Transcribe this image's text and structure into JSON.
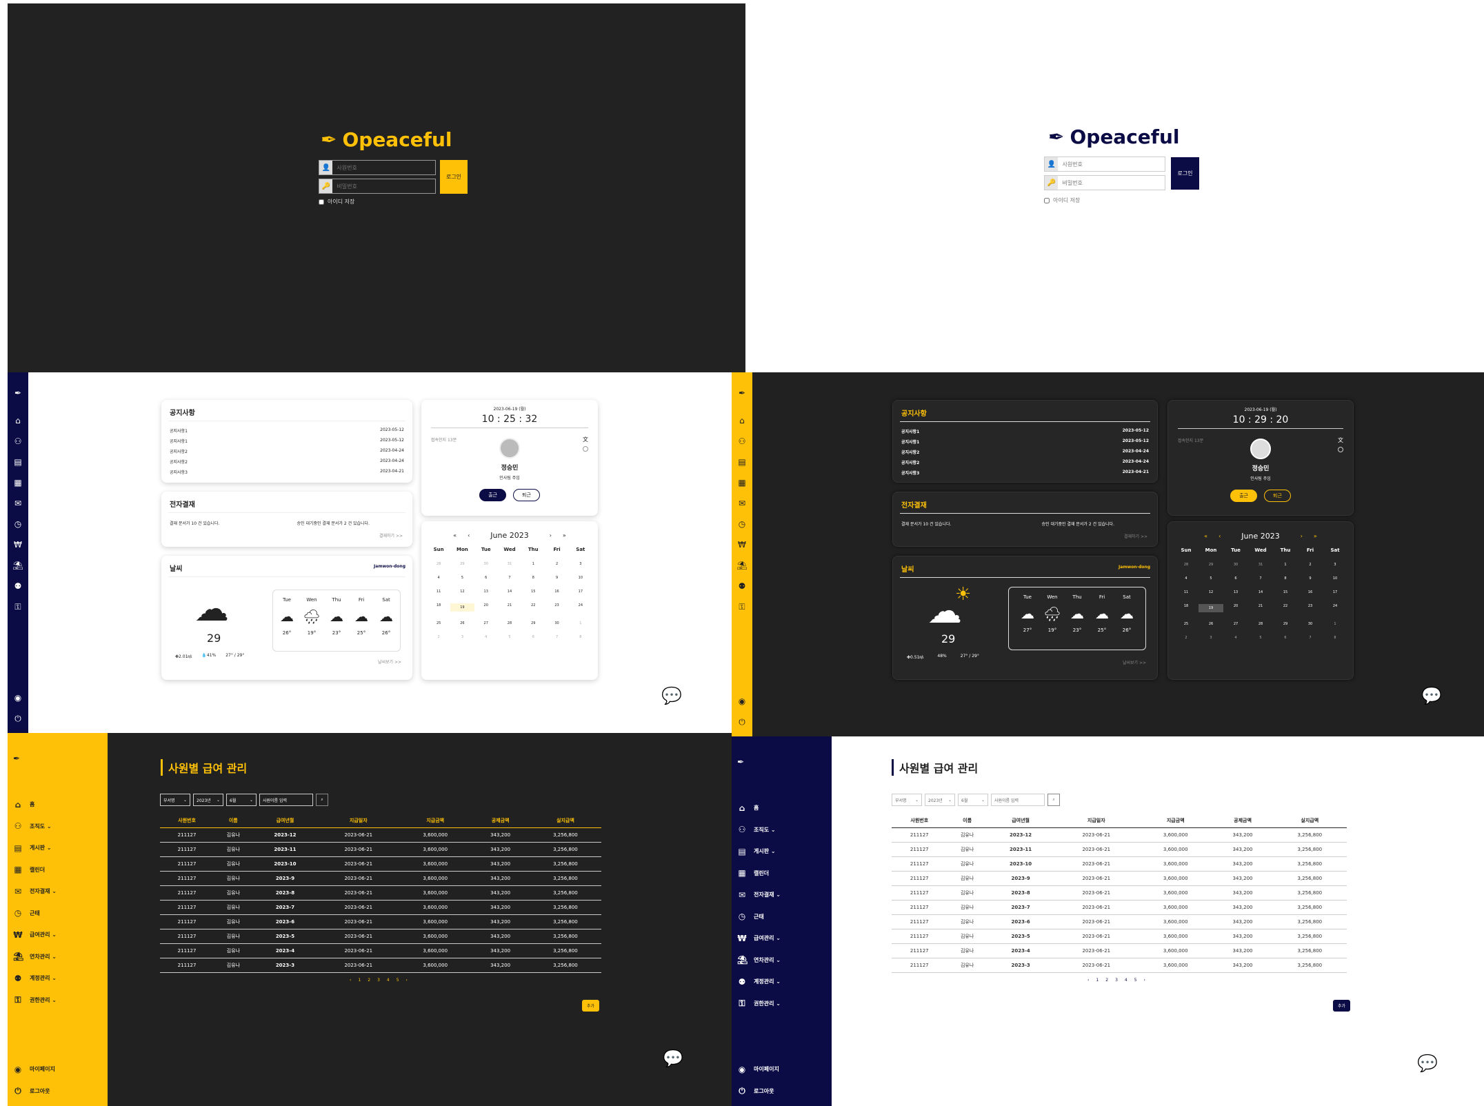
{
  "brand": "Opeaceful",
  "login": {
    "employee_placeholder": "사원번호",
    "password_placeholder": "비밀번호",
    "login_button": "로그인",
    "remember_label": "아이디 저장"
  },
  "dashboard": {
    "notice_title": "공지사항",
    "notices": [
      {
        "title": "공지사항1",
        "date": "2023-05-12"
      },
      {
        "title": "공지사항1",
        "date": "2023-05-12"
      },
      {
        "title": "공지사항2",
        "date": "2023-04-24"
      },
      {
        "title": "공지사항2",
        "date": "2023-04-24"
      },
      {
        "title": "공지사항3",
        "date": "2023-04-21"
      }
    ],
    "approval_title": "전자결재",
    "approval_text_1": "결재 문서가 10 건 있습니다.",
    "approval_text_2": "승인 대기중인 결재 문서가 2 건 있습니다.",
    "approval_link": "결재하기 >>",
    "weather_title": "날씨",
    "location": "Jamwon-dong",
    "temp_now": "29",
    "wind": "2.01㎧",
    "humidity": "41%",
    "range": "27° / 29°",
    "wind_dark": "0.51㎧",
    "humidity_dark": "48%",
    "weather_link": "날씨보기 >>",
    "forecast": [
      {
        "day": "Tue",
        "temp": "26°"
      },
      {
        "day": "Wen",
        "temp": "19°"
      },
      {
        "day": "Thu",
        "temp": "23°"
      },
      {
        "day": "Fri",
        "temp": "25°"
      },
      {
        "day": "Sat",
        "temp": "26°"
      }
    ],
    "forecast_dark": [
      "27°",
      "19°",
      "23°",
      "25°",
      "26°"
    ],
    "date_light": "2023-06-19 (월)",
    "time_light": "10 : 25 : 32",
    "date_dark": "2023-06-19 (월)",
    "time_dark": "10 : 29 : 20",
    "visit_label": "접속한지 13분",
    "user_name": "정승민",
    "user_dept": "인사팀 주임",
    "checkin": "출근",
    "checkout": "퇴근",
    "cal_month": "June 2023",
    "cal_days": [
      "Sun",
      "Mon",
      "Tue",
      "Wed",
      "Thu",
      "Fri",
      "Sat"
    ],
    "cal_cells": [
      "28",
      "29",
      "30",
      "31",
      "1",
      "2",
      "3",
      "4",
      "5",
      "6",
      "7",
      "8",
      "9",
      "10",
      "11",
      "12",
      "13",
      "14",
      "15",
      "16",
      "17",
      "18",
      "19",
      "20",
      "21",
      "22",
      "23",
      "24",
      "25",
      "26",
      "27",
      "28",
      "29",
      "30",
      "1",
      "2",
      "3",
      "4",
      "5",
      "6",
      "7",
      "8"
    ]
  },
  "payroll": {
    "title": "사원별 급여 관리",
    "filters": [
      "부서명",
      "2023년",
      "6월",
      "사원이름 입력"
    ],
    "columns": [
      "사원번호",
      "이름",
      "급여년월",
      "지급일자",
      "지급금액",
      "공제금액",
      "실지급액"
    ],
    "rows": [
      [
        "211127",
        "김유나",
        "2023-12",
        "2023-06-21",
        "3,600,000",
        "343,200",
        "3,256,800"
      ],
      [
        "211127",
        "김유나",
        "2023-11",
        "2023-06-21",
        "3,600,000",
        "343,200",
        "3,256,800"
      ],
      [
        "211127",
        "김유나",
        "2023-10",
        "2023-06-21",
        "3,600,000",
        "343,200",
        "3,256,800"
      ],
      [
        "211127",
        "김유나",
        "2023-9",
        "2023-06-21",
        "3,600,000",
        "343,200",
        "3,256,800"
      ],
      [
        "211127",
        "김유나",
        "2023-8",
        "2023-06-21",
        "3,600,000",
        "343,200",
        "3,256,800"
      ],
      [
        "211127",
        "김유나",
        "2023-7",
        "2023-06-21",
        "3,600,000",
        "343,200",
        "3,256,800"
      ],
      [
        "211127",
        "김유나",
        "2023-6",
        "2023-06-21",
        "3,600,000",
        "343,200",
        "3,256,800"
      ],
      [
        "211127",
        "김유나",
        "2023-5",
        "2023-06-21",
        "3,600,000",
        "343,200",
        "3,256,800"
      ],
      [
        "211127",
        "김유나",
        "2023-4",
        "2023-06-21",
        "3,600,000",
        "343,200",
        "3,256,800"
      ],
      [
        "211127",
        "김유나",
        "2023-3",
        "2023-06-21",
        "3,600,000",
        "343,200",
        "3,256,800"
      ]
    ],
    "pages": [
      "‹",
      "1",
      "2",
      "3",
      "4",
      "5",
      "›"
    ],
    "add_button": "추가"
  },
  "sidebar": [
    {
      "label": "홈",
      "icon": "home-icon",
      "glyph": "⌂"
    },
    {
      "label": "조직도 ⌄",
      "icon": "org-chart-icon",
      "glyph": "⚇"
    },
    {
      "label": "게시판 ⌄",
      "icon": "board-icon",
      "glyph": "▤"
    },
    {
      "label": "캘린더",
      "icon": "calendar-icon",
      "glyph": "▦"
    },
    {
      "label": "전자결재 ⌄",
      "icon": "approval-icon",
      "glyph": "✉"
    },
    {
      "label": "근태",
      "icon": "clock-icon",
      "glyph": "◷"
    },
    {
      "label": "급여관리 ⌄",
      "icon": "payroll-icon",
      "glyph": "₩"
    },
    {
      "label": "연차관리 ⌄",
      "icon": "vacation-icon",
      "glyph": "⛱"
    },
    {
      "label": "계정관리 ⌄",
      "icon": "account-icon",
      "glyph": "⚉"
    },
    {
      "label": "권한관리 ⌄",
      "icon": "permission-icon",
      "glyph": "⚿"
    }
  ],
  "sidebar_bottom": [
    {
      "label": "마이페이지",
      "icon": "mypage-icon",
      "glyph": "◉"
    },
    {
      "label": "로그아웃",
      "icon": "logout-icon",
      "glyph": "⏻"
    }
  ],
  "colors": {
    "yellow": "#ffc107",
    "navy": "#0b0b45",
    "dark": "#212121"
  }
}
